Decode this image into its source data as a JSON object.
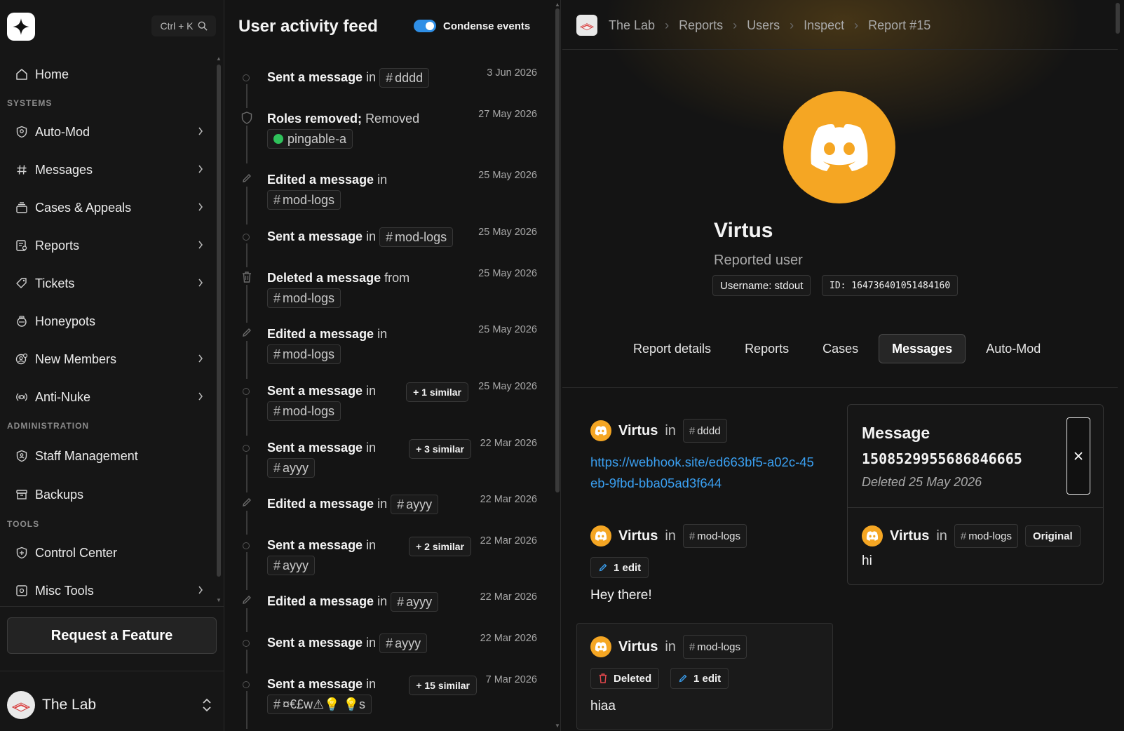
{
  "sidebar": {
    "search_shortcut": "Ctrl + K",
    "sections": {
      "systems": "SYSTEMS",
      "administration": "ADMINISTRATION",
      "tools": "TOOLS"
    },
    "items": [
      {
        "label": "Home",
        "icon": "home-icon",
        "has_chevron": false
      },
      {
        "label": "Auto-Mod",
        "icon": "shield-icon",
        "has_chevron": true
      },
      {
        "label": "Messages",
        "icon": "hash-icon",
        "has_chevron": true
      },
      {
        "label": "Cases & Appeals",
        "icon": "layers-icon",
        "has_chevron": true
      },
      {
        "label": "Reports",
        "icon": "report-icon",
        "has_chevron": true
      },
      {
        "label": "Tickets",
        "icon": "ticket-icon",
        "has_chevron": true
      },
      {
        "label": "Honeypots",
        "icon": "honeypot-icon",
        "has_chevron": false
      },
      {
        "label": "New Members",
        "icon": "user-plus-icon",
        "has_chevron": true
      },
      {
        "label": "Anti-Nuke",
        "icon": "radar-icon",
        "has_chevron": true
      },
      {
        "label": "Staff Management",
        "icon": "staff-shield-icon",
        "has_chevron": false
      },
      {
        "label": "Backups",
        "icon": "archive-icon",
        "has_chevron": false
      },
      {
        "label": "Control Center",
        "icon": "control-icon",
        "has_chevron": false
      },
      {
        "label": "Misc Tools",
        "icon": "misc-icon",
        "has_chevron": true
      }
    ],
    "request_feature": "Request a Feature",
    "server_name": "The Lab"
  },
  "feed": {
    "title": "User activity feed",
    "condense_label": "Condense events",
    "condense_on": true,
    "events": [
      {
        "action": "Sent a message",
        "prep": "in",
        "channel": "dddd",
        "date": "3 Jun 2026",
        "icon": "circle-icon",
        "similar": ""
      },
      {
        "action": "Roles removed;",
        "prep": "Removed",
        "channel": "pingable-a",
        "date": "27 May 2026",
        "icon": "shield-outline-icon",
        "similar": "",
        "is_role": true
      },
      {
        "action": "Edited a message",
        "prep": "in",
        "channel": "mod-logs",
        "date": "25 May 2026",
        "icon": "pencil-icon",
        "similar": ""
      },
      {
        "action": "Sent a message",
        "prep": "in",
        "channel": "mod-logs",
        "date": "25 May 2026",
        "icon": "circle-icon",
        "similar": ""
      },
      {
        "action": "Deleted a message",
        "prep": "from",
        "channel": "mod-logs",
        "date": "25 May 2026",
        "icon": "trash-icon",
        "similar": ""
      },
      {
        "action": "Edited a message",
        "prep": "in",
        "channel": "mod-logs",
        "date": "25 May 2026",
        "icon": "pencil-icon",
        "similar": ""
      },
      {
        "action": "Sent a message",
        "prep": "in",
        "channel": "mod-logs",
        "date": "25 May 2026",
        "icon": "circle-icon",
        "similar": "+ 1 similar"
      },
      {
        "action": "Sent a message",
        "prep": "in",
        "channel": "ayyy",
        "date": "22 Mar 2026",
        "icon": "circle-icon",
        "similar": "+ 3 similar"
      },
      {
        "action": "Edited a message",
        "prep": "in",
        "channel": "ayyy",
        "date": "22 Mar 2026",
        "icon": "pencil-icon",
        "similar": ""
      },
      {
        "action": "Sent a message",
        "prep": "in",
        "channel": "ayyy",
        "date": "22 Mar 2026",
        "icon": "circle-icon",
        "similar": "+ 2 similar"
      },
      {
        "action": "Edited a message",
        "prep": "in",
        "channel": "ayyy",
        "date": "22 Mar 2026",
        "icon": "pencil-icon",
        "similar": ""
      },
      {
        "action": "Sent a message",
        "prep": "in",
        "channel": "ayyy",
        "date": "22 Mar 2026",
        "icon": "circle-icon",
        "similar": ""
      },
      {
        "action": "Sent a message",
        "prep": "in",
        "channel": "¤€£w⚠💡 💡s",
        "date": "7 Mar 2026",
        "icon": "circle-icon",
        "similar": "+ 15 similar"
      }
    ]
  },
  "report": {
    "breadcrumbs": [
      "The Lab",
      "Reports",
      "Users",
      "Inspect",
      "Report #15"
    ],
    "user_name": "Virtus",
    "user_role": "Reported user",
    "username_tag": "Username: stdout",
    "id_tag": "ID: 164736401051484160",
    "tabs": [
      "Report details",
      "Reports",
      "Cases",
      "Messages",
      "Auto-Mod"
    ],
    "active_tab": "Messages",
    "messages": [
      {
        "author": "Virtus",
        "in": "in",
        "channel": "dddd",
        "link": "https://webhook.site/ed663bf5-a02c-45eb-9fbd-bba05ad3f644"
      },
      {
        "author": "Virtus",
        "in": "in",
        "channel": "mod-logs",
        "edit_badge": "1 edit",
        "body": "Hey there!"
      },
      {
        "author": "Virtus",
        "in": "in",
        "channel": "mod-logs",
        "deleted_badge": "Deleted",
        "edit_badge": "1 edit",
        "body": "hiaa"
      }
    ],
    "detail": {
      "title": "Message",
      "message_id": "1508529955686846665",
      "subtitle": "Deleted 25 May 2026",
      "author": "Virtus",
      "in": "in",
      "channel": "mod-logs",
      "badge": "Original",
      "body": "hi"
    }
  },
  "colors": {
    "accent_blue": "#2f8fe6",
    "link": "#3a9ff0",
    "avatar_orange": "#f5a623",
    "role_green": "#2fc25b",
    "delete_red": "#e5484d"
  }
}
